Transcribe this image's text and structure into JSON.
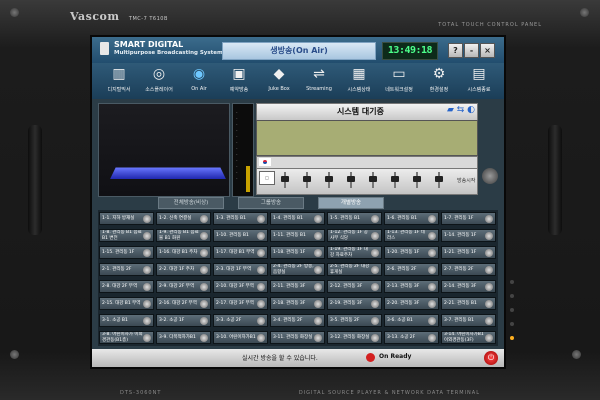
{
  "device": {
    "brand": "Vascom",
    "model": "TMC-7 T610B",
    "panel_label": "TOTAL TOUCH CONTROL PANEL",
    "bottom_left_label": "DTS-3060NT",
    "bottom_right_label": "DIGITAL SOURCE PLAYER & NETWORK DATA TERMINAL"
  },
  "app": {
    "title": "SMART DIGITAL",
    "subtitle": "Multipurpose Broadcasting System",
    "status_banner": "생방송(On Air)",
    "clock": "13:49:18",
    "window_buttons": [
      "?",
      "-",
      "×"
    ]
  },
  "toolbar": [
    {
      "label": "디지털믹서",
      "icon": "mixer-icon"
    },
    {
      "label": "소스플레이어",
      "icon": "disc-icon"
    },
    {
      "label": "On Air",
      "icon": "on-air-icon"
    },
    {
      "label": "예약방송",
      "icon": "schedule-icon"
    },
    {
      "label": "Juke Box",
      "icon": "jukebox-icon"
    },
    {
      "label": "Streaming",
      "icon": "streaming-icon"
    },
    {
      "label": "시스템상태",
      "icon": "monitor-icon"
    },
    {
      "label": "네트워크설정",
      "icon": "network-icon"
    },
    {
      "label": "환경설정",
      "icon": "settings-icon"
    },
    {
      "label": "시스템종료",
      "icon": "exit-icon"
    }
  ],
  "system": {
    "status": "시스템 대기중",
    "send_label": "방송시작"
  },
  "tabs": [
    {
      "label": "전체방송(비상)"
    },
    {
      "label": "그룹방송"
    },
    {
      "label": "개별방송",
      "active": true
    }
  ],
  "zones": [
    [
      "1-1. 지하 방재실",
      "1-2. 신축 연결실",
      "1-3. 관리동 B1",
      "1-4. 관리동 B1",
      "1-5. 관리동 B1",
      "1-6. 관리동 B1",
      "1-7. 관리동 1F"
    ],
    [
      "1-8. 관리동 B1 음료 B1 변전",
      "1-9. 관리동 B1 음료물 B1 화원",
      "1-10. 관리동 B1",
      "1-11. 관리동 B1",
      "1-12. 관리동 1F 공사무 식당",
      "1-13. 관리동 1F 테라스",
      "1-14. 관리동 1F"
    ],
    [
      "1-15. 관리동 1F",
      "1-16. 대강 B1 주차",
      "1-17. 대강 B1 무역",
      "1-18. 관리동 1F",
      "1-19. 관리동 1F 대강 자료주차",
      "1-20. 관리동 1F",
      "1-21. 관리동 1F"
    ],
    [
      "2-1. 관리동 2F",
      "2-2. 대강 1F 주차",
      "2-3. 대강 1F 무역",
      "2-4. 관리동 2F 방송, 음향실",
      "2-5. 관리동 2F 대강 휴게실",
      "2-6. 관리동 2F",
      "2-7. 관리동 2F"
    ],
    [
      "2-8. 대강 2F 무역",
      "2-9. 대강 2F 무역",
      "2-10. 대강 3F 무역",
      "2-11. 관리동 3F",
      "2-12. 관리동 3F",
      "2-13. 관리동 3F",
      "2-14. 관리동 3F"
    ],
    [
      "2-15. 대강 B1 무역",
      "2-16. 대강 2F 무역",
      "2-17. 대강 3F 무역",
      "2-18. 관리동 3F",
      "2-19. 관리동 3F",
      "2-20. 관리동 3F",
      "2-21. 관리동 B1"
    ],
    [
      "3-1. 소공 B1",
      "3-2. 소공 1F",
      "3-3. 소공 2F",
      "3-4. 관리동 2F",
      "3-5. 관리동 2F",
      "3-6. 소공 B1",
      "3-7. 관리동 B1"
    ],
    [
      "3-8. 어린이자가 이외경관동(B1층)",
      "3-9. 다목적자가B1",
      "3-10. 어린이자가B1",
      "3-11. 관리동 화장실",
      "3-12. 관리동 화장실",
      "3-13. 소공 2F",
      "3-14. 어린이자가B1 이외경관동(3F)"
    ]
  ],
  "bottom": {
    "message": "실시간 방송을 할 수 있습니다.",
    "ready": "On Ready"
  },
  "colors": {
    "titlebar": "#2f5a78",
    "banner_text": "#2a4d8a",
    "clock_digits": "#4cff8a",
    "ready_icon": "#d32020"
  }
}
